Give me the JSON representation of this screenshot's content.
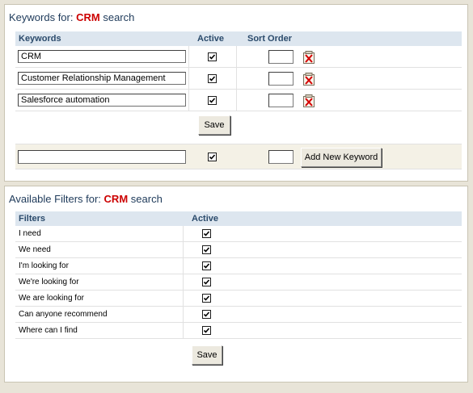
{
  "keywords_panel": {
    "title_prefix": "Keywords for:",
    "search_term": "CRM",
    "title_suffix": "search",
    "headers": {
      "keywords": "Keywords",
      "active": "Active",
      "sort_order": "Sort Order"
    },
    "rows": [
      {
        "keyword": "CRM",
        "active": true,
        "sort_order": ""
      },
      {
        "keyword": "Customer Relationship Management",
        "active": true,
        "sort_order": ""
      },
      {
        "keyword": "Salesforce automation",
        "active": true,
        "sort_order": ""
      }
    ],
    "save_label": "Save",
    "new_keyword": {
      "value": "",
      "active": true,
      "sort_order": "",
      "add_label": "Add New Keyword"
    }
  },
  "filters_panel": {
    "title_prefix": "Available Filters for:",
    "search_term": "CRM",
    "title_suffix": "search",
    "headers": {
      "filters": "Filters",
      "active": "Active"
    },
    "rows": [
      {
        "label": "I need",
        "active": true
      },
      {
        "label": "We need",
        "active": true
      },
      {
        "label": "I'm looking for",
        "active": true
      },
      {
        "label": "We're looking for",
        "active": true
      },
      {
        "label": "We are looking for",
        "active": true
      },
      {
        "label": "Can anyone recommend",
        "active": true
      },
      {
        "label": "Where can I find",
        "active": true
      }
    ],
    "save_label": "Save"
  },
  "icons": {
    "delete": "delete-x-icon",
    "checkmark": "checkmark-icon"
  },
  "colors": {
    "accent_term": "#cc0000",
    "header_bg": "#dde6ef",
    "add_row_bg": "#f4f1e6"
  }
}
